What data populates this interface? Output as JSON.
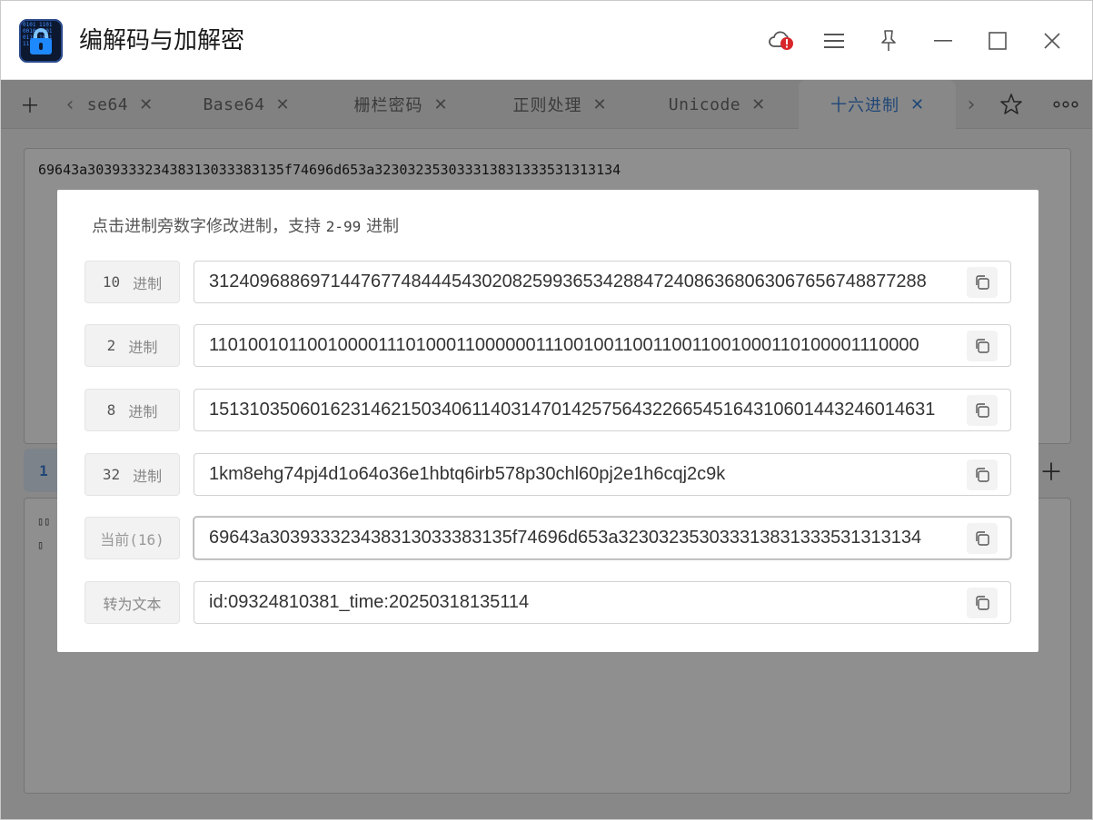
{
  "app": {
    "title": "编解码与加解密",
    "icon_digits": "0101 1101 0010 1101 0110 1001 1110 0101"
  },
  "tabs": [
    {
      "label": "se64",
      "icon": "close-icon"
    },
    {
      "label": "Base64",
      "icon": "close-icon"
    },
    {
      "label": "栅栏密码",
      "icon": "close-icon"
    },
    {
      "label": "正则处理",
      "icon": "close-icon"
    },
    {
      "label": "Unicode",
      "icon": "close-icon"
    },
    {
      "label": "十六进制",
      "icon": "close-icon",
      "active": true
    }
  ],
  "main": {
    "input_text": "69643a303933323438313033383135f74696d653a323032353033313831333531313134",
    "bottom_tab_number": "1",
    "output_glyphs": [
      "▯▯",
      "▯",
      "▯"
    ]
  },
  "dialog": {
    "hint_prefix": "点击进制旁数字修改进制，支持",
    "hint_range": "2-99",
    "hint_suffix": "进制",
    "rows": [
      {
        "num": "10",
        "unit": "进制",
        "value": "31240968869714476774844454302082599365342884724086368063067656748877288"
      },
      {
        "num": "2",
        "unit": "进制",
        "value": "110100101100100001110100011000000111001001100110011001000110100001110000"
      },
      {
        "num": "8",
        "unit": "进制",
        "value": "151310350601623146215034061140314701425756432266545164310601443246014631"
      },
      {
        "num": "32",
        "unit": "进制",
        "value": "1km8ehg74pj4d1o64o36e1hbtq6irb578p30chl60pj2e1h6cqj2c9k"
      },
      {
        "label": "当前(16)",
        "value": "69643a303933323438313033383135f74696d653a323032353033313831333531313134"
      },
      {
        "label": "转为文本",
        "value": "id:09324810381_time:20250318135114"
      }
    ]
  },
  "colors": {
    "accent": "#3a7fd5",
    "alert": "#d8262b",
    "overlay": "rgba(0,0,0,0.44)"
  }
}
